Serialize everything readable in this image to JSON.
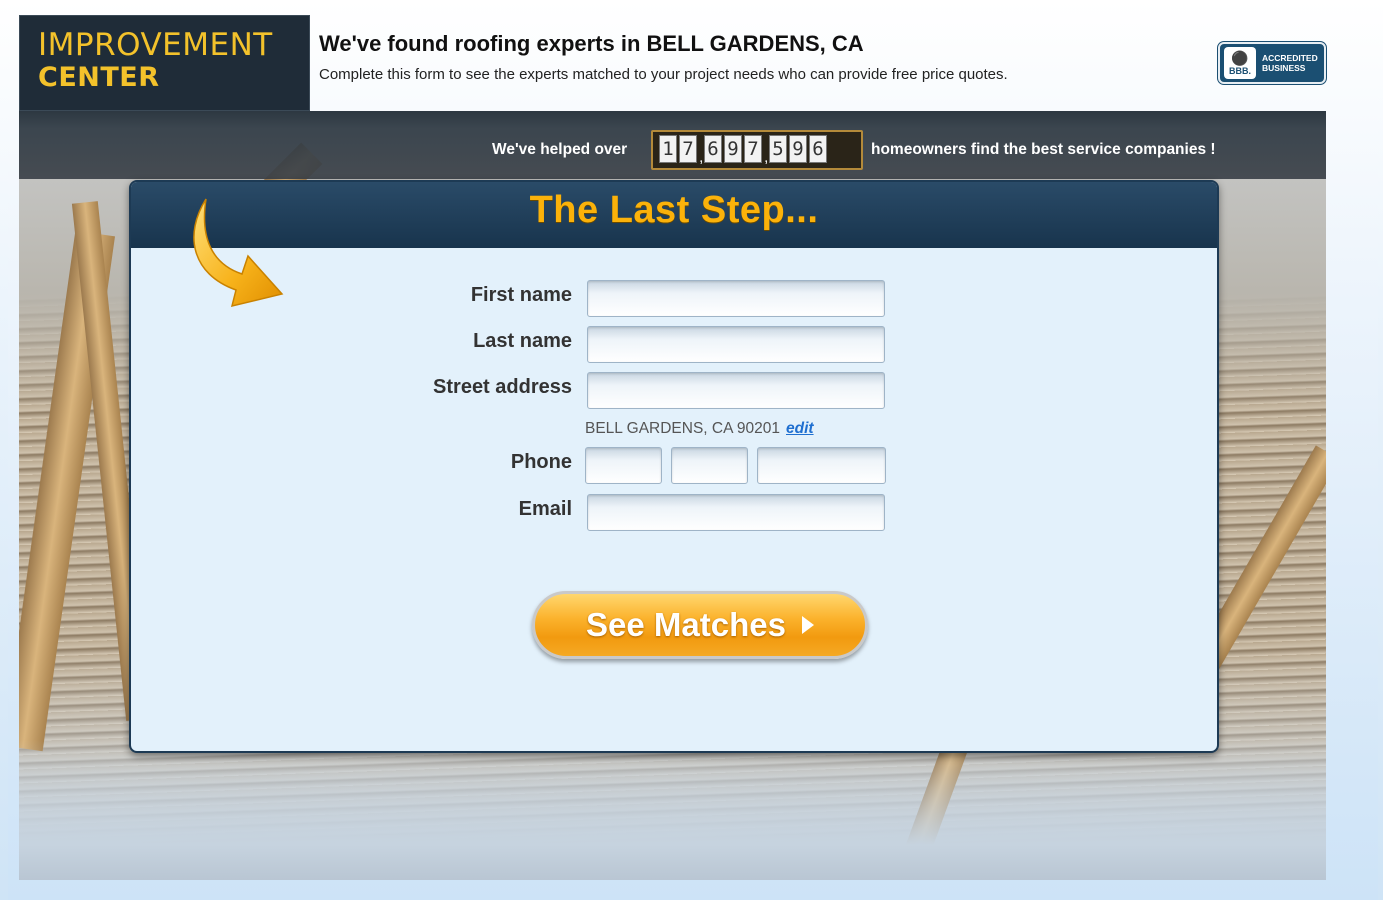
{
  "header": {
    "logo_line1": "IMPROVEMENT",
    "logo_line2": "CENTER",
    "headline": "We've found roofing experts in BELL GARDENS, CA",
    "subline": "Complete this form to see the experts matched to your project needs who can provide free price quotes.",
    "badge": {
      "seal_text": "BBB.",
      "line1": "ACCREDITED",
      "line2": "BUSINESS",
      "color": "#1b4f72"
    }
  },
  "counter_bar": {
    "prefix": "We've helped over",
    "digits": [
      "1",
      "7",
      ",",
      "6",
      "9",
      "7",
      ",",
      "5",
      "9",
      "6"
    ],
    "suffix": "homeowners find the best service companies !"
  },
  "form": {
    "title": "The Last Step...",
    "first_name": {
      "label": "First name",
      "value": ""
    },
    "last_name": {
      "label": "Last name",
      "value": ""
    },
    "street": {
      "label": "Street address",
      "value": ""
    },
    "location": {
      "text": "BELL GARDENS, CA  90201",
      "edit_label": "edit"
    },
    "phone": {
      "label": "Phone",
      "area": "",
      "prefix": "",
      "line": ""
    },
    "email": {
      "label": "Email",
      "value": ""
    },
    "submit_label": "See Matches"
  },
  "colors": {
    "accent": "#fbb20a",
    "panel_bg": "#e3f1fb",
    "panel_header": "#1d3a54",
    "link": "#1f6fd0"
  },
  "icons": [
    "bbb-torch-icon",
    "curved-arrow-icon",
    "play-triangle-icon"
  ]
}
